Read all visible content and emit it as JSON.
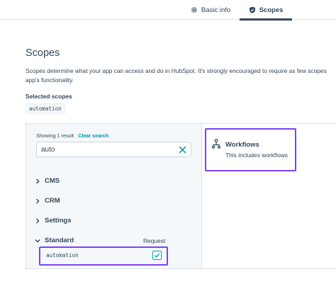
{
  "tabs": [
    {
      "label": "Basic info",
      "icon": "gear-icon",
      "active": false
    },
    {
      "label": "Scopes",
      "icon": "shield-icon",
      "active": true
    }
  ],
  "page": {
    "title": "Scopes",
    "description_line1": "Scopes determine what your app can access and do in HubSpot. It's strongly encouraged to require as few scopes",
    "description_line2": "app's functionality.",
    "selected_label": "Selected scopes",
    "selected_chip": "automation"
  },
  "finder": {
    "results_text": "Showing 1 result",
    "clear_label": "Clear search",
    "search_value": "auto",
    "categories": [
      "CMS",
      "CRM",
      "Settings",
      "Standard"
    ],
    "request_label": "Request",
    "scope_item": {
      "name": "automation",
      "checked": true
    }
  },
  "detail": {
    "title": "Workflows",
    "subtitle": "This includes workflows",
    "icon": "workflow-icon"
  },
  "colors": {
    "highlight": "#7b42f6",
    "checkbox": "#00a4bd",
    "link": "#0091ae",
    "text": "#33475b"
  }
}
